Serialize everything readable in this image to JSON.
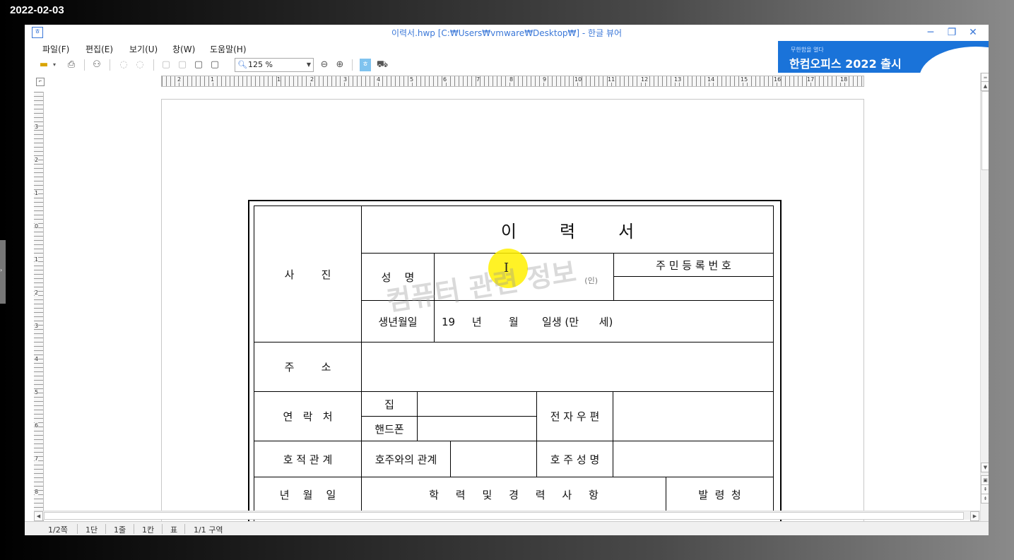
{
  "date_stamp": "2022-02-03",
  "window": {
    "title": "이력서.hwp [C:₩Users₩vmware₩Desktop₩] - 한글 뷰어"
  },
  "menu": [
    "파일(F)",
    "편집(E)",
    "보기(U)",
    "창(W)",
    "도움말(H)"
  ],
  "toolbar": {
    "zoom": "125 %"
  },
  "ad": {
    "small": "무한함을 열다",
    "big": "한컴오피스 2022 출시"
  },
  "ruler": {
    "h": [
      "2",
      "1",
      "1",
      "2",
      "3",
      "4",
      "5",
      "6",
      "7",
      "8",
      "9",
      "10",
      "11",
      "12",
      "13",
      "14",
      "15",
      "16",
      "17",
      "18"
    ],
    "v": [
      "3",
      "2",
      "1",
      "0",
      "1",
      "2",
      "3",
      "4",
      "5",
      "6",
      "7",
      "8",
      "9"
    ]
  },
  "form": {
    "title": "이        력        서",
    "photo": "사        진",
    "name_label": "성    명",
    "seal": "(인)",
    "id_label": "주 민 등 록 번 호",
    "birth_label": "생년월일",
    "birth_value": "19     년        월       일생 (만      세)",
    "address_label": "주        소",
    "contact_label": "연   락   처",
    "home_label": "집",
    "phone_label": "핸드폰",
    "email_label": "전 자 우 편",
    "family_label": "호 적 관 계",
    "relation_label": "호주와의 관계",
    "head_name_label": "호 주 성 명",
    "date_label": "년    월    일",
    "history_label": "학     력     및     경     력     사     항",
    "issuer_label": "발  령  청"
  },
  "watermark": "컴퓨터 관련 정보",
  "status": [
    "1/2쪽",
    "1단",
    "1줄",
    "1칸",
    "표",
    "1/1 구역"
  ]
}
